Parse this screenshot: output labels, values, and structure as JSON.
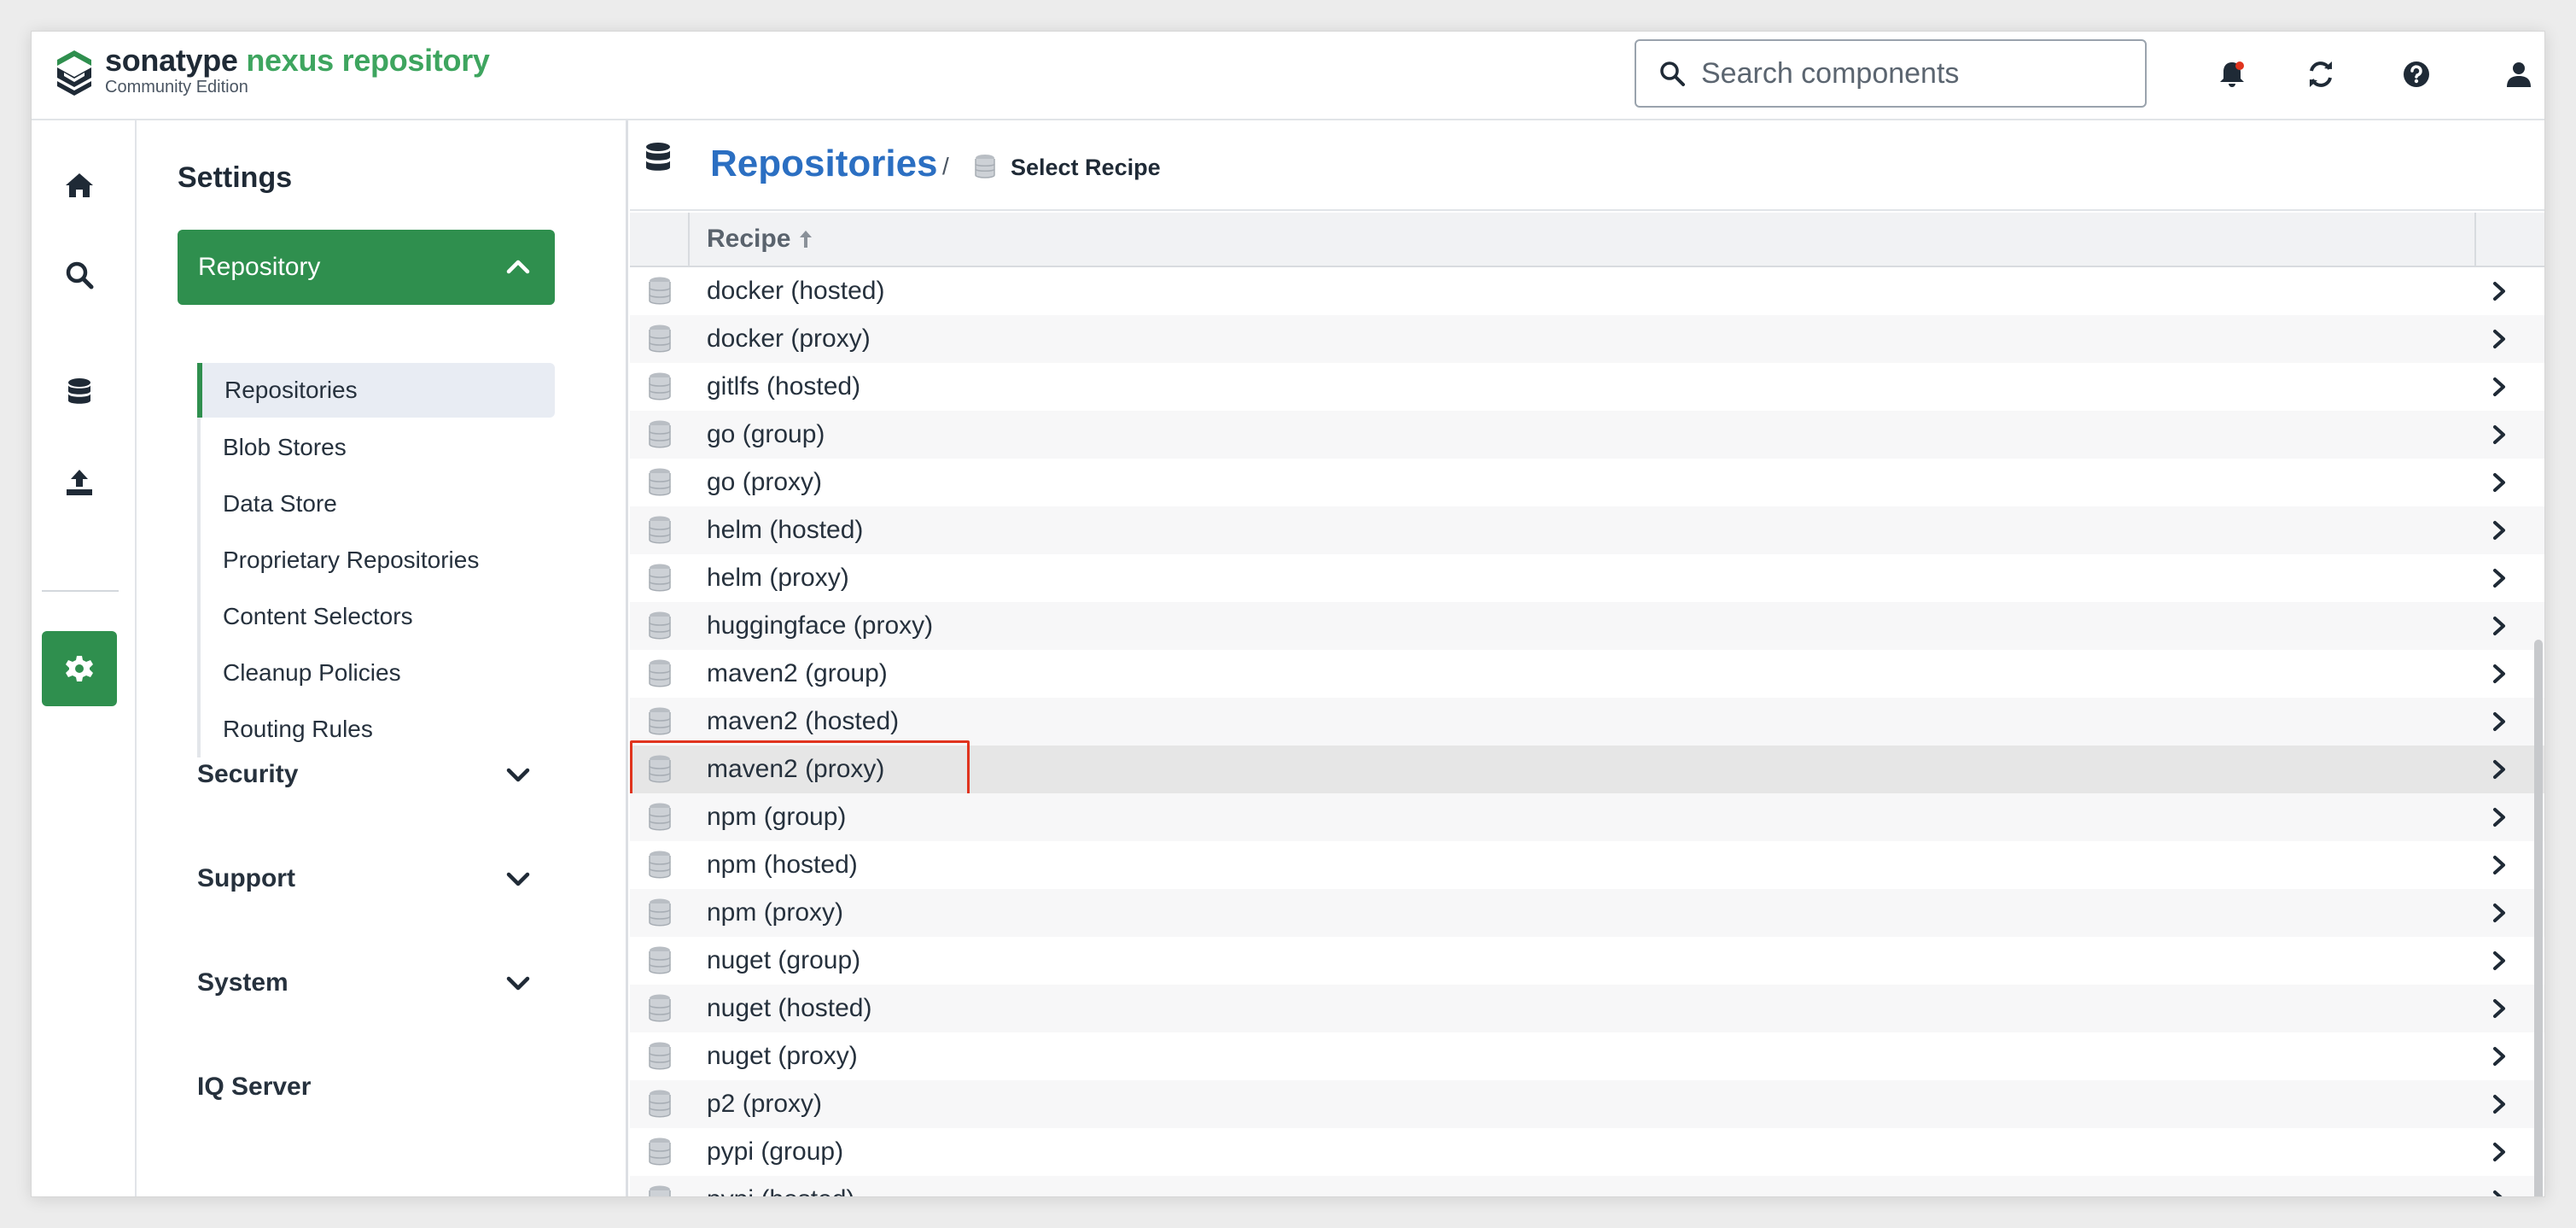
{
  "app": {
    "brand_word1": "sonatype",
    "brand_word2": "nexus repository",
    "edition": "Community Edition",
    "accent_color": "#2f8f4e",
    "link_color": "#2b6fc2"
  },
  "header": {
    "search_placeholder": "Search components",
    "icons": [
      "bell-icon",
      "refresh-icon",
      "help-icon",
      "user-icon"
    ],
    "notification_dot_color": "#e0341e"
  },
  "rail": {
    "items": [
      "home-icon",
      "search-icon",
      "database-icon",
      "upload-icon",
      "gear-icon"
    ],
    "active": "gear-icon"
  },
  "settings": {
    "title": "Settings",
    "repository_section": "Repository",
    "subitems": [
      "Repositories",
      "Blob Stores",
      "Data Store",
      "Proprietary Repositories",
      "Content Selectors",
      "Cleanup Policies",
      "Routing Rules"
    ],
    "active_subitem": "Repositories",
    "sections": [
      "Security",
      "Support",
      "System",
      "IQ Server"
    ]
  },
  "breadcrumb": {
    "title": "Repositories",
    "separator": "/",
    "current": "Select Recipe"
  },
  "grid": {
    "column_header": "Recipe",
    "sort": "ascending",
    "selected": "maven2 (proxy)",
    "rows": [
      "docker (hosted)",
      "docker (proxy)",
      "gitlfs (hosted)",
      "go (group)",
      "go (proxy)",
      "helm (hosted)",
      "helm (proxy)",
      "huggingface (proxy)",
      "maven2 (group)",
      "maven2 (hosted)",
      "maven2 (proxy)",
      "npm (group)",
      "npm (hosted)",
      "npm (proxy)",
      "nuget (group)",
      "nuget (hosted)",
      "nuget (proxy)",
      "p2 (proxy)",
      "pypi (group)",
      "pypi (hosted)"
    ]
  }
}
